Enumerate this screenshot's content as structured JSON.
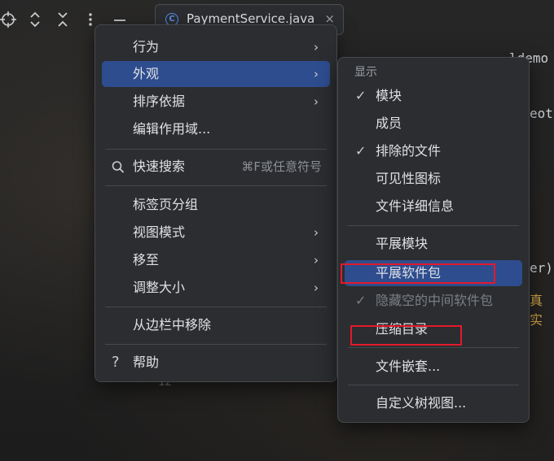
{
  "toolbar": {
    "icons": [
      "crosshair-icon",
      "expand-collapse-icon",
      "collapse-all-icon",
      "more-vertical-icon",
      "minimize-icon"
    ]
  },
  "editor": {
    "tab_label": "PaymentService.java",
    "tab_icon": "C",
    "close_glyph": "×",
    "code_fragments": [
      "ldemo",
      "eot",
      "er)",
      "真实"
    ],
    "line_number": "12"
  },
  "menu1": {
    "items": [
      {
        "label": "行为",
        "submenu": true
      },
      {
        "label": "外观",
        "submenu": true,
        "selected": true
      },
      {
        "label": "排序依据",
        "submenu": true
      },
      {
        "label": "编辑作用域..."
      },
      {
        "label": "快速搜索",
        "icon": "search-icon",
        "shortcut": "⌘F或任意符号"
      },
      {
        "label": "标签页分组"
      },
      {
        "label": "视图模式",
        "submenu": true
      },
      {
        "label": "移至",
        "submenu": true
      },
      {
        "label": "调整大小",
        "submenu": true
      },
      {
        "label": "从边栏中移除"
      },
      {
        "label": "帮助",
        "icon": "help-icon"
      }
    ]
  },
  "menu2": {
    "header": "显示",
    "items": [
      {
        "label": "模块",
        "checked": true
      },
      {
        "label": "成员"
      },
      {
        "label": "排除的文件",
        "checked": true
      },
      {
        "label": "可见性图标"
      },
      {
        "label": "文件详细信息"
      },
      {
        "label": "平展模块"
      },
      {
        "label": "平展软件包",
        "selected": true
      },
      {
        "label": "隐藏空的中间软件包",
        "checked": true,
        "disabled": true
      },
      {
        "label": "压缩目录"
      },
      {
        "label": "文件嵌套..."
      },
      {
        "label": "自定义树视图..."
      }
    ]
  },
  "glyphs": {
    "arrow": "›",
    "check": "✓",
    "search": "⌕",
    "help": "?"
  },
  "colors": {
    "selection": "#2e4d8f",
    "annotation": "#e5192b",
    "menu_bg": "#2b2d30"
  }
}
